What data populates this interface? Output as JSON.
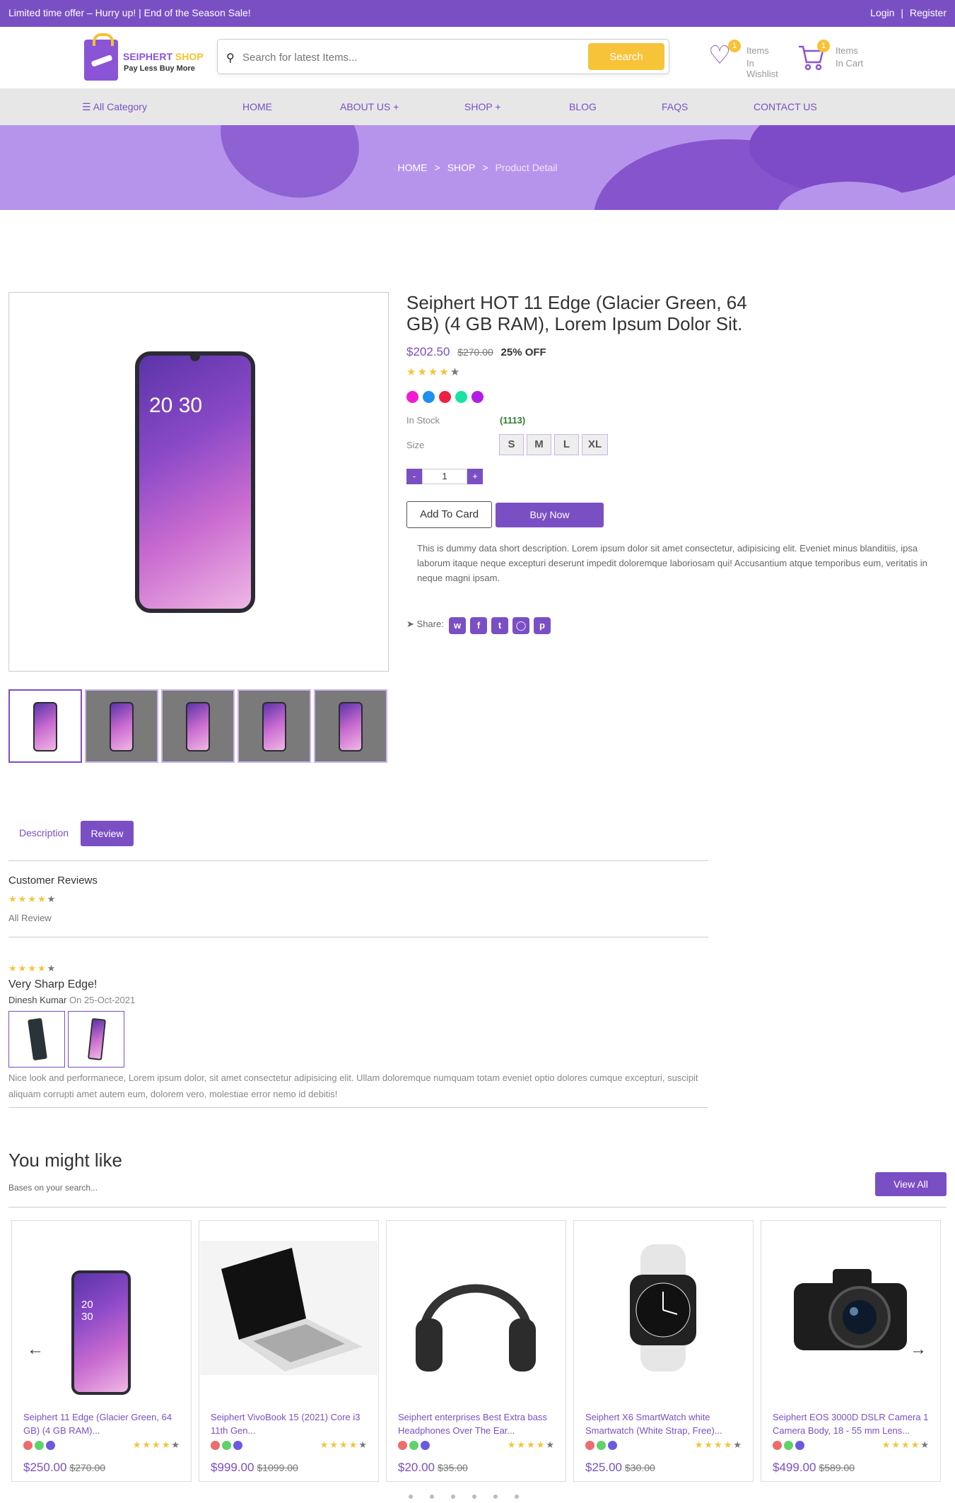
{
  "topbar": {
    "offer": "Limited time offer – Hurry up!  |  End of the Season Sale!",
    "login": "Login",
    "sep": "|",
    "register": "Register"
  },
  "logo": {
    "brand1": "SEIPHERT",
    "brand2": "SHOP",
    "tagline": "Pay Less Buy More"
  },
  "search": {
    "placeholder": "Search for latest Items...",
    "button": "Search"
  },
  "wishlist": {
    "count": "1",
    "line1": "Items",
    "line2": "In Wishlist"
  },
  "cart": {
    "count": "1",
    "line1": "Items",
    "line2": "In Cart"
  },
  "nav": {
    "category": "All Category",
    "items": [
      "HOME",
      "ABOUT US +",
      "SHOP +",
      "BLOG",
      "FAQS",
      "CONTACT US"
    ]
  },
  "breadcrumb": {
    "home": "HOME",
    "shop": "SHOP",
    "current": "Product Detail",
    "sep": ">"
  },
  "product": {
    "title": "Seiphert HOT 11 Edge (Glacier Green, 64 GB) (4 GB RAM), Lorem Ipsum Dolor Sit.",
    "price": "$202.50",
    "old_price": "$270.00",
    "discount": "25% OFF",
    "rating": 4,
    "colors": [
      "#f21bd2",
      "#1e90f0",
      "#ee1f3f",
      "#19e2a3",
      "#b21ee8"
    ],
    "stock_label": "In Stock",
    "stock_value": "(1113)",
    "size_label": "Size",
    "sizes": [
      "S",
      "M",
      "L",
      "XL"
    ],
    "qty_minus": "-",
    "qty_value": "1",
    "qty_plus": "+",
    "add_to_cart": "Add To Card",
    "buy_now": "Buy Now",
    "phone_time": "20 30",
    "description": "This is dummy data short description. Lorem ipsum dolor sit amet consectetur, adipisicing elit. Eveniet minus blanditiis, ipsa laborum itaque neque excepturi deserunt impedit doloremque laboriosam qui! Accusantium atque temporibus eum, veritatis in neque magni ipsam.",
    "share_label": "Share:",
    "share_icons": [
      "whatsapp-icon",
      "facebook-icon",
      "twitter-icon",
      "instagram-icon",
      "pinterest-icon"
    ]
  },
  "tabs": {
    "description": "Description",
    "review": "Review"
  },
  "reviews": {
    "heading": "Customer Reviews",
    "rating": 4,
    "all_label": "All Review",
    "item": {
      "rating": 4,
      "title": "Very Sharp Edge!",
      "author": "Dinesh Kumar",
      "date": "On 25-Oct-2021",
      "text": "Nice look and performanece, Lorem ipsum dolor, sit amet consectetur adipisicing elit. Ullam doloremque numquam totam eveniet optio dolores cumque excepturi, suscipit aliquam corrupti amet autem eum, dolorem vero, molestiae error nemo id debitis!"
    }
  },
  "suggestions": {
    "title": "You might like",
    "subtitle": "Bases on your search...",
    "view_all": "View All",
    "prev": "←",
    "next": "→",
    "items": [
      {
        "name": "Seiphert 11 Edge (Glacier Green, 64 GB) (4 GB RAM)...",
        "price": "$250.00",
        "old": "$270.00",
        "image": "phone",
        "rating": 4
      },
      {
        "name": "Seiphert VivoBook 15 (2021) Core i3 11th Gen...",
        "price": "$999.00",
        "old": "$1099.00",
        "image": "laptop",
        "rating": 4
      },
      {
        "name": "Seiphert enterprises Best Extra bass Headphones Over The Ear...",
        "price": "$20.00",
        "old": "$35.00",
        "image": "headphones",
        "rating": 4
      },
      {
        "name": "Seiphert X6 SmartWatch white Smartwatch (White Strap, Free)...",
        "price": "$25.00",
        "old": "$30.00",
        "image": "watch",
        "rating": 4
      },
      {
        "name": "Seiphert EOS 3000D DSLR Camera 1 Camera Body, 18 - 55 mm Lens...",
        "price": "$499.00",
        "old": "$589.00",
        "image": "camera",
        "rating": 4
      }
    ],
    "dot_colors": [
      "#ee6b6e",
      "#5fd26a",
      "#6a5ae0"
    ]
  }
}
